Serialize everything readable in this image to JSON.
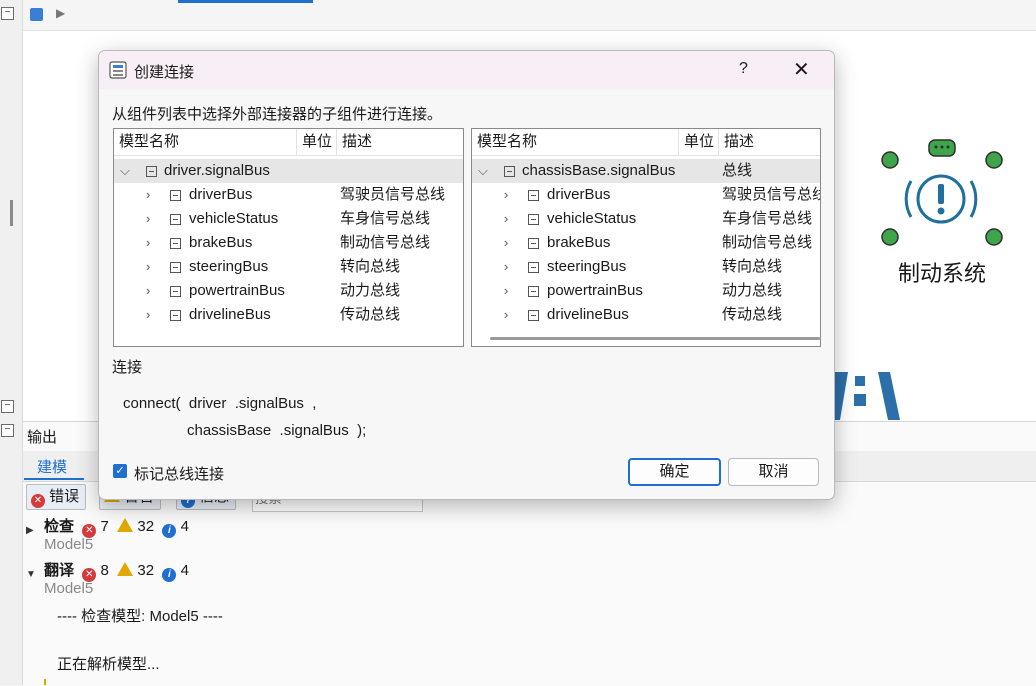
{
  "output_panel": {
    "title": "输出",
    "tab_model": "建模",
    "filters": {
      "errors": "错误",
      "warnings": "警告",
      "info": "信息"
    },
    "search_placeholder": "搜索",
    "check": {
      "label": "检查",
      "errors": "7",
      "warnings": "32",
      "info": "4",
      "model": "Model5"
    },
    "translate": {
      "label": "翻译",
      "errors": "8",
      "warnings": "32",
      "info": "4",
      "model": "Model5"
    },
    "log_line1": "---- 检查模型: Model5 ----",
    "log_line2": "正在解析模型..."
  },
  "canvas": {
    "component_label": "制动系统"
  },
  "dialog": {
    "title": "创建连接",
    "help": "?",
    "close": "✕",
    "instruction": "从组件列表中选择外部连接器的子组件进行连接。",
    "left_tree": {
      "columns": [
        "模型名称",
        "单位",
        "描述"
      ],
      "root": {
        "name": "driver.signalBus",
        "desc": ""
      },
      "children": [
        {
          "name": "driverBus",
          "desc": "驾驶员信号总线"
        },
        {
          "name": "vehicleStatus",
          "desc": "车身信号总线"
        },
        {
          "name": "brakeBus",
          "desc": "制动信号总线"
        },
        {
          "name": "steeringBus",
          "desc": "转向总线"
        },
        {
          "name": "powertrainBus",
          "desc": "动力总线"
        },
        {
          "name": "drivelineBus",
          "desc": "传动总线"
        }
      ]
    },
    "right_tree": {
      "columns": [
        "模型名称",
        "单位",
        "描述"
      ],
      "root": {
        "name": "chassisBase.signalBus",
        "desc": "总线"
      },
      "children": [
        {
          "name": "driverBus",
          "desc": "驾驶员信号总线"
        },
        {
          "name": "vehicleStatus",
          "desc": "车身信号总线"
        },
        {
          "name": "brakeBus",
          "desc": "制动信号总线"
        },
        {
          "name": "steeringBus",
          "desc": "转向总线"
        },
        {
          "name": "powertrainBus",
          "desc": "动力总线"
        },
        {
          "name": "drivelineBus",
          "desc": "传动总线"
        }
      ]
    },
    "connect_label": "连接",
    "code_line1": "connect(  driver  .signalBus  ,",
    "code_line2": "chassisBase  .signalBus  );",
    "checkbox_label": "标记总线连接",
    "checkbox_checked": true,
    "ok_label": "确定",
    "cancel_label": "取消"
  }
}
